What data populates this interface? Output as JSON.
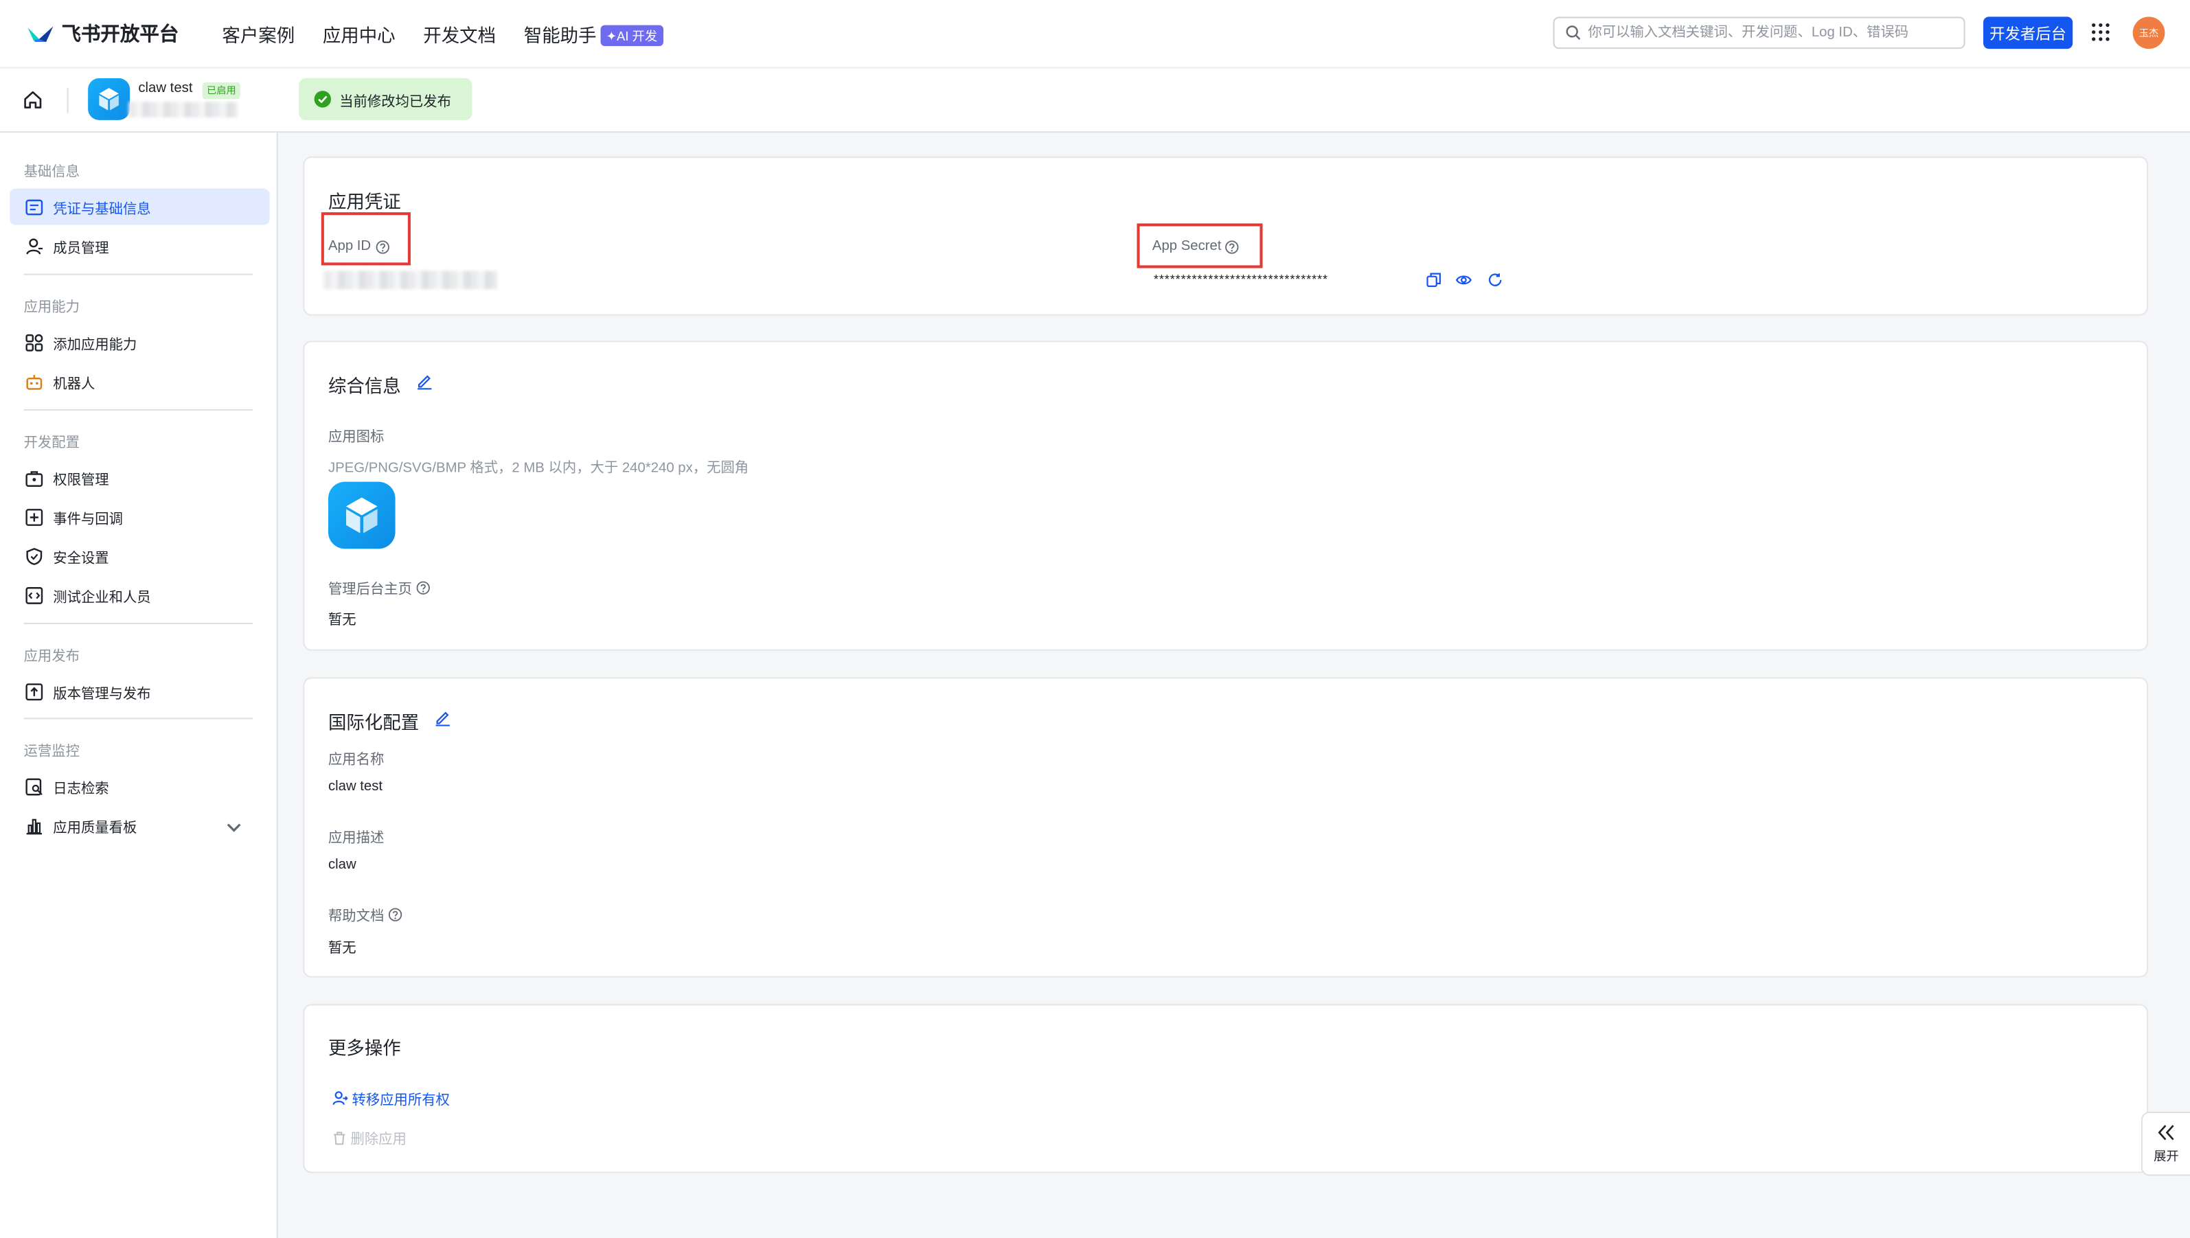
{
  "nav": {
    "brand": "飞书开放平台",
    "links": [
      "客户案例",
      "应用中心",
      "开发文档",
      "智能助手"
    ],
    "ai_badge": "✦AI 开发",
    "search_placeholder": "你可以输入文档关键词、开发问题、Log ID、错误码",
    "dev_button": "开发者后台",
    "avatar_text": "玉杰"
  },
  "app": {
    "name": "claw test",
    "status": "已启用"
  },
  "toast": "当前修改均已发布",
  "sidebar": {
    "groups": [
      "基础信息",
      "应用能力",
      "开发配置",
      "应用发布",
      "运营监控"
    ],
    "items": [
      "凭证与基础信息",
      "成员管理",
      "添加应用能力",
      "机器人",
      "权限管理",
      "事件与回调",
      "安全设置",
      "测试企业和人员",
      "版本管理与发布",
      "日志检索",
      "应用质量看板"
    ]
  },
  "credentials": {
    "title": "应用凭证",
    "app_id_label": "App ID",
    "app_secret_label": "App Secret",
    "app_secret_value": "********************************"
  },
  "general": {
    "title": "综合信息",
    "icon_label": "应用图标",
    "icon_hint": "JPEG/PNG/SVG/BMP 格式，2 MB 以内，大于 240*240 px，无圆角",
    "admin_label": "管理后台主页",
    "admin_value": "暂无"
  },
  "i18n": {
    "title": "国际化配置",
    "name_label": "应用名称",
    "name_value": "claw test",
    "desc_label": "应用描述",
    "desc_value": "claw",
    "help_label": "帮助文档",
    "help_value": "暂无"
  },
  "more": {
    "title": "更多操作",
    "transfer": "转移应用所有权",
    "delete": "删除应用"
  },
  "expand_label": "展开",
  "colors": {
    "primary": "#1456f0",
    "success": "#2ea121",
    "highlight": "#e53935"
  }
}
